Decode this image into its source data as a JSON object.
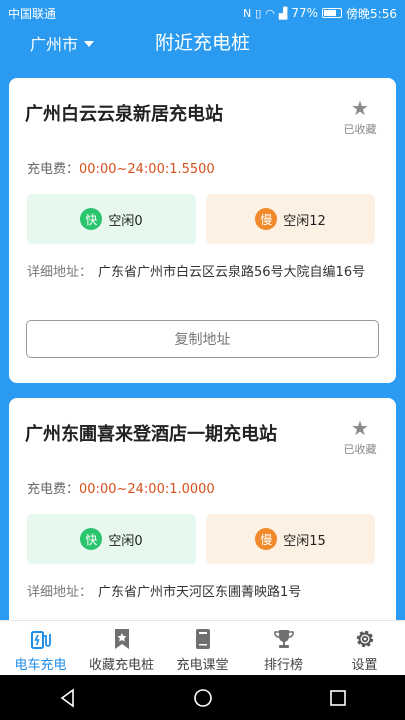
{
  "status_bar": {
    "carrier": "中国联通",
    "battery_percent_label": "77%",
    "battery_level": 0.77,
    "time": "傍晚5:56"
  },
  "header": {
    "city": "广州市",
    "title": "附近充电桩"
  },
  "stations": [
    {
      "name": "广州白云云泉新居充电站",
      "favorite_label": "已收藏",
      "fee_label": "充电费：",
      "fee_value": "00:00~24:00:1.5500",
      "fast_badge": "快",
      "fast_text": "空闲0",
      "slow_badge": "慢",
      "slow_text": "空闲12",
      "address_label": "详细地址：",
      "address": "广东省广州市白云区云泉路56号大院自编16号",
      "copy_button": "复制地址"
    },
    {
      "name": "广州东圃喜来登酒店一期充电站",
      "favorite_label": "已收藏",
      "fee_label": "充电费：",
      "fee_value": "00:00~24:00:1.0000",
      "fast_badge": "快",
      "fast_text": "空闲0",
      "slow_badge": "慢",
      "slow_text": "空闲15",
      "address_label": "详细地址：",
      "address": "广东省广州市天河区东圃菁映路1号"
    }
  ],
  "tabs": [
    {
      "label": "电车充电",
      "icon": "charging-station-icon",
      "active": true
    },
    {
      "label": "收藏充电桩",
      "icon": "bookmark-star-icon",
      "active": false
    },
    {
      "label": "充电课堂",
      "icon": "book-icon",
      "active": false
    },
    {
      "label": "排行榜",
      "icon": "trophy-icon",
      "active": false
    },
    {
      "label": "设置",
      "icon": "gear-icon",
      "active": false
    }
  ],
  "colors": {
    "primary": "#2a9bf0",
    "tab_active": "#1e8de8",
    "fee": "#d9501e",
    "fast": "#2bc46e",
    "slow": "#f08a2c"
  }
}
